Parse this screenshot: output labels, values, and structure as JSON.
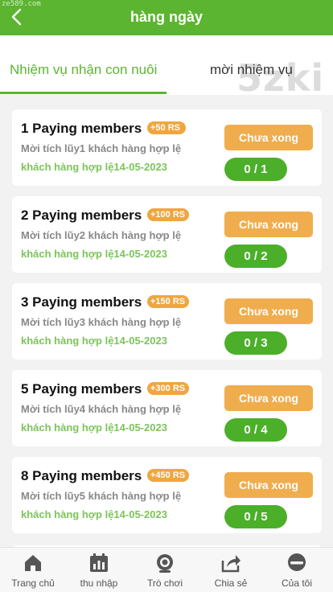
{
  "watermark": "ze589.com",
  "header": {
    "title": "hàng ngày",
    "back_icon": "chevron-left-icon"
  },
  "tabs": [
    {
      "label": "Nhiệm vụ nhận con nuôi",
      "active": true
    },
    {
      "label": "mời nhiệm vụ",
      "active": false
    }
  ],
  "brand_watermark": "5zki",
  "tasks": [
    {
      "title": "1 Paying members",
      "badge": "+50 RS",
      "desc": "Mời tích lũy1 khách hàng hợp lệ",
      "date": "khách hàng hợp lệ14-05-2023",
      "status": "Chưa xong",
      "progress": "0 / 1"
    },
    {
      "title": "2 Paying members",
      "badge": "+100 RS",
      "desc": "Mời tích lũy2 khách hàng hợp lệ",
      "date": "khách hàng hợp lệ14-05-2023",
      "status": "Chưa xong",
      "progress": "0 / 2"
    },
    {
      "title": "3 Paying members",
      "badge": "+150 RS",
      "desc": "Mời tích lũy3 khách hàng hợp lệ",
      "date": "khách hàng hợp lệ14-05-2023",
      "status": "Chưa xong",
      "progress": "0 / 3"
    },
    {
      "title": "5 Paying members",
      "badge": "+300 RS",
      "desc": "Mời tích lũy4 khách hàng hợp lệ",
      "date": "khách hàng hợp lệ14-05-2023",
      "status": "Chưa xong",
      "progress": "0 / 4"
    },
    {
      "title": "8 Paying members",
      "badge": "+450 RS",
      "desc": "Mời tích lũy5 khách hàng hợp lệ",
      "date": "khách hàng hợp lệ14-05-2023",
      "status": "Chưa xong",
      "progress": "0 / 5"
    }
  ],
  "bottom_nav": [
    {
      "label": "Trang chủ",
      "icon": "home-icon"
    },
    {
      "label": "thu nhập",
      "icon": "calendar-chart-icon"
    },
    {
      "label": "Trò chơi",
      "icon": "camera-icon"
    },
    {
      "label": "Chia sẻ",
      "icon": "share-icon"
    },
    {
      "label": "Của tôi",
      "icon": "user-circle-icon"
    }
  ],
  "colors": {
    "primary": "#5cb531",
    "accent": "#f0ad4e",
    "progress": "#4caf2a"
  }
}
